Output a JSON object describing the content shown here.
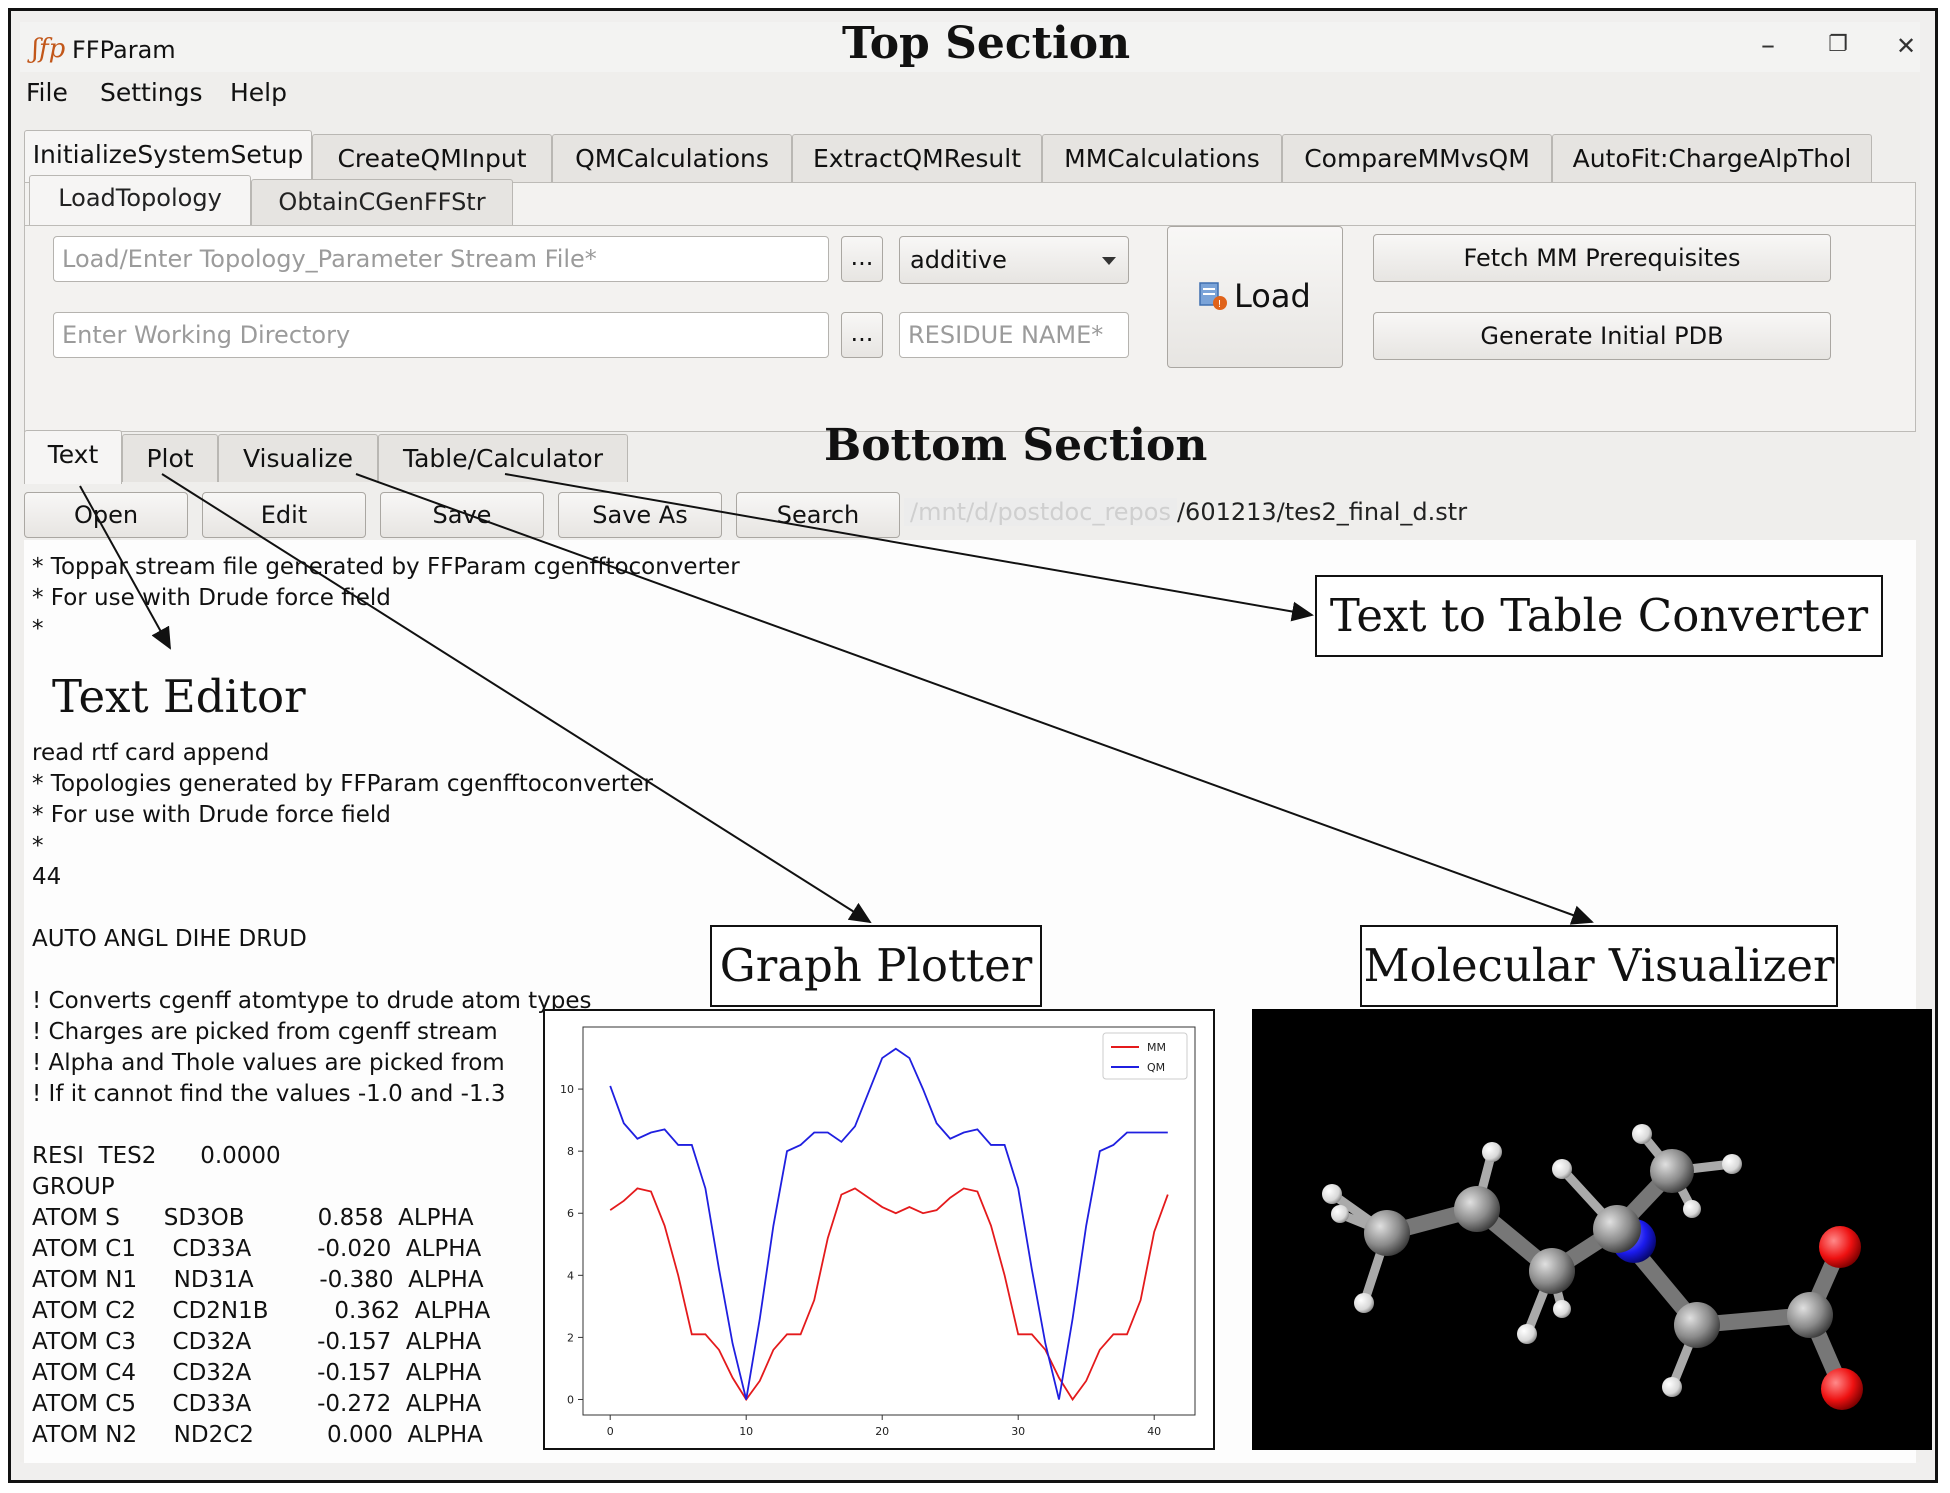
{
  "window": {
    "title": "FFParam",
    "logo_glyph": "ʃfp",
    "minimize_glyph": "–",
    "restore_glyph": "❐",
    "close_glyph": "✕"
  },
  "menu": [
    "File",
    "Settings",
    "Help"
  ],
  "main_tabs": [
    "InitializeSystemSetup",
    "CreateQMInput",
    "QMCalculations",
    "ExtractQMResult",
    "MMCalculations",
    "CompareMMvsQM",
    "AutoFit:ChargeAlpThol"
  ],
  "sub_tabs": [
    "LoadTopology",
    "ObtainCGenFFStr"
  ],
  "setup": {
    "topology_placeholder": "Load/Enter Topology_Parameter Stream File*",
    "workdir_placeholder": "Enter Working Directory",
    "browse_label": "...",
    "mode_value": "additive",
    "residue_placeholder": "RESIDUE NAME*",
    "load_label": "Load",
    "fetch_label": "Fetch MM Prerequisites",
    "generate_label": "Generate Initial PDB"
  },
  "bottom_tabs": [
    "Text",
    "Plot",
    "Visualize",
    "Table/Calculator"
  ],
  "toolbar": [
    "Open",
    "Edit",
    "Save",
    "Save As",
    "Search"
  ],
  "file_path": {
    "dim_part": "/mnt/d/postdoc_repos",
    "visible_part": "/601213/tes2_final_d.str"
  },
  "annotations": {
    "top_section": "Top Section",
    "bottom_section": "Bottom Section",
    "text_editor": "Text Editor",
    "text_to_table": "Text to Table Converter",
    "graph_plotter": "Graph Plotter",
    "molecular_visualizer": "Molecular Visualizer"
  },
  "editor_lines": [
    "* Toppar stream file generated by FFParam cgenfftoconverter",
    "* For use with Drude force field",
    "*",
    "",
    "",
    "",
    "read rtf card append",
    "* Topologies generated by FFParam cgenfftoconverter",
    "* For use with Drude force field",
    "*",
    "44",
    "",
    "AUTO ANGL DIHE DRUD",
    "",
    "! Converts cgenff atomtype to drude atom types",
    "! Charges are picked from cgenff stream",
    "! Alpha and Thole values are picked from                                                                    urre",
    "! If it cannot find the values -1.0 and -1.3",
    "",
    "RESI  TES2      0.0000",
    "GROUP",
    "ATOM S      SD3OB          0.858  ALPHA",
    "ATOM C1     CD33A         -0.020  ALPHA",
    "ATOM N1     ND31A         -0.380  ALPHA",
    "ATOM C2     CD2N1B         0.362  ALPHA",
    "ATOM C3     CD32A         -0.157  ALPHA",
    "ATOM C4     CD32A         -0.157  ALPHA",
    "ATOM C5     CD33A         -0.272  ALPHA",
    "ATOM N2     ND2C2          0.000  ALPHA"
  ],
  "chart_data": {
    "type": "line",
    "x": [
      0,
      1,
      2,
      3,
      4,
      5,
      6,
      7,
      8,
      9,
      10,
      11,
      12,
      13,
      14,
      15,
      16,
      17,
      18,
      19,
      20,
      21,
      22,
      23,
      24,
      25,
      26,
      27,
      28,
      29,
      30,
      31,
      32,
      33,
      34,
      35,
      36,
      37,
      38,
      39,
      40,
      41
    ],
    "series": [
      {
        "name": "MM",
        "color": "#e41a1c",
        "values": [
          6.1,
          6.4,
          6.8,
          6.7,
          5.6,
          4.0,
          2.1,
          2.1,
          1.6,
          0.7,
          0.0,
          0.6,
          1.6,
          2.1,
          2.1,
          3.2,
          5.2,
          6.6,
          6.8,
          6.5,
          6.2,
          6.0,
          6.2,
          6.0,
          6.1,
          6.5,
          6.8,
          6.7,
          5.6,
          4.0,
          2.1,
          2.1,
          1.6,
          0.7,
          0.0,
          0.6,
          1.6,
          2.1,
          2.1,
          3.2,
          5.4,
          6.6
        ]
      },
      {
        "name": "QM",
        "color": "#1f1fe0",
        "values": [
          10.1,
          8.9,
          8.4,
          8.6,
          8.7,
          8.2,
          8.2,
          6.8,
          4.2,
          1.8,
          0.0,
          2.6,
          5.6,
          8.0,
          8.2,
          8.6,
          8.6,
          8.3,
          8.8,
          9.9,
          11.0,
          11.3,
          11.0,
          10.0,
          8.9,
          8.4,
          8.6,
          8.7,
          8.2,
          8.2,
          6.8,
          4.2,
          1.8,
          0.0,
          2.6,
          5.6,
          8.0,
          8.2,
          8.6,
          8.6,
          8.6,
          8.6
        ]
      }
    ],
    "xticks": [
      0,
      10,
      20,
      30,
      40
    ],
    "yticks": [
      0,
      2,
      4,
      6,
      8,
      10
    ],
    "xlim": [
      -2,
      43
    ],
    "ylim": [
      -0.5,
      12
    ],
    "legend_position": "top-right",
    "grid": false
  }
}
